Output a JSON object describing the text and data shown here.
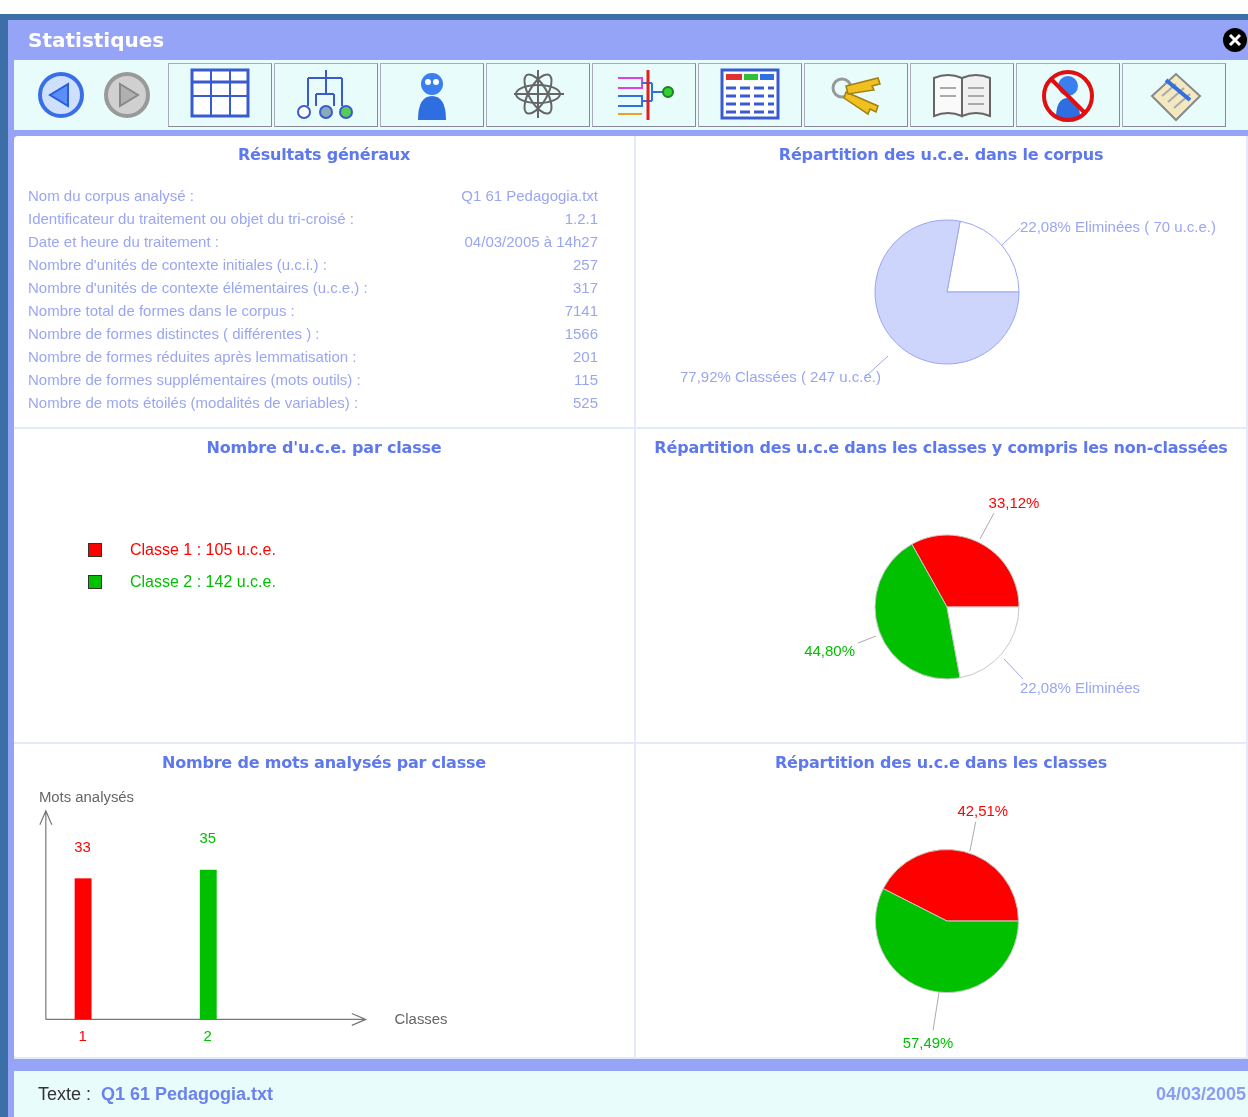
{
  "window": {
    "title": "Statistiques"
  },
  "toolbar": {
    "nav": [
      {
        "kind": "back",
        "disabled": false
      },
      {
        "kind": "forward",
        "disabled": true
      }
    ],
    "buttons": [
      {
        "kind": "table"
      },
      {
        "kind": "tree"
      },
      {
        "kind": "person"
      },
      {
        "kind": "atom"
      },
      {
        "kind": "dendrogram"
      },
      {
        "kind": "list"
      },
      {
        "kind": "keys"
      },
      {
        "kind": "book"
      },
      {
        "kind": "forbidden"
      },
      {
        "kind": "notepad"
      }
    ]
  },
  "general_results": {
    "title": "Résultats généraux",
    "rows": [
      {
        "label": "Nom du corpus analysé :",
        "value": "Q1 61 Pedagogia.txt"
      },
      {
        "label": "Identificateur du traitement ou objet du tri-croisé :",
        "value": "1.2.1"
      },
      {
        "label": "Date et heure du traitement :",
        "value": "04/03/2005 à 14h27"
      },
      {
        "label": "Nombre d'unités de contexte initiales (u.c.i.) :",
        "value": "257"
      },
      {
        "label": "Nombre d'unités de contexte élémentaires (u.c.e.) :",
        "value": "317"
      },
      {
        "label": "Nombre total de formes dans le corpus :",
        "value": "7141"
      },
      {
        "label": "Nombre de formes distinctes ( différentes ) :",
        "value": "1566"
      },
      {
        "label": "Nombre de formes réduites après lemmatisation :",
        "value": "201"
      },
      {
        "label": "Nombre de formes supplémentaires (mots outils) :",
        "value": "115"
      },
      {
        "label": "Nombre de mots étoilés (modalités de variables) :",
        "value": "525"
      }
    ]
  },
  "corpus_distribution": {
    "title": "Répartition des u.c.e. dans le corpus",
    "chart_data": {
      "type": "pie",
      "categories": [
        "22,08% Eliminées ( 70 u.c.e.)",
        "77,92% Classées ( 247 u.c.e.)"
      ],
      "values": [
        22.08,
        77.92
      ],
      "colors": [
        "#ffffff",
        "#cdd5fc"
      ]
    }
  },
  "uce_per_class": {
    "title": "Nombre d'u.c.e. par classe",
    "legend": [
      {
        "label": "Classe 1 : 105 u.c.e.",
        "color": "#ff0000"
      },
      {
        "label": "Classe 2 : 142 u.c.e.",
        "color": "#00c000"
      }
    ]
  },
  "class_distribution_all": {
    "title": "Répartition des u.c.e dans les classes y compris les non-classées",
    "chart_data": {
      "type": "pie",
      "categories": [
        "33,12%",
        "44,80%",
        "22,08% Eliminées"
      ],
      "values": [
        33.12,
        44.8,
        22.08
      ],
      "colors": [
        "#ff0000",
        "#00c000",
        "#ffffff"
      ]
    }
  },
  "words_per_class": {
    "title": "Nombre de mots analysés par classe",
    "chart_data": {
      "type": "bar",
      "xlabel": "Classes",
      "ylabel": "Mots analysés",
      "categories": [
        "1",
        "2"
      ],
      "data_labels": true,
      "values": [
        33,
        35
      ],
      "colors": [
        "#ff0000",
        "#00c000"
      ]
    }
  },
  "class_distribution": {
    "title": "Répartition des u.c.e dans les classes",
    "chart_data": {
      "type": "pie",
      "categories": [
        "42,51%",
        "57,49%"
      ],
      "values": [
        42.51,
        57.49
      ],
      "colors": [
        "#ff0000",
        "#00c000"
      ]
    }
  },
  "status_bar": {
    "label": "Texte :",
    "file": "Q1 61 Pedagogia.txt",
    "date": "04/03/2005"
  }
}
